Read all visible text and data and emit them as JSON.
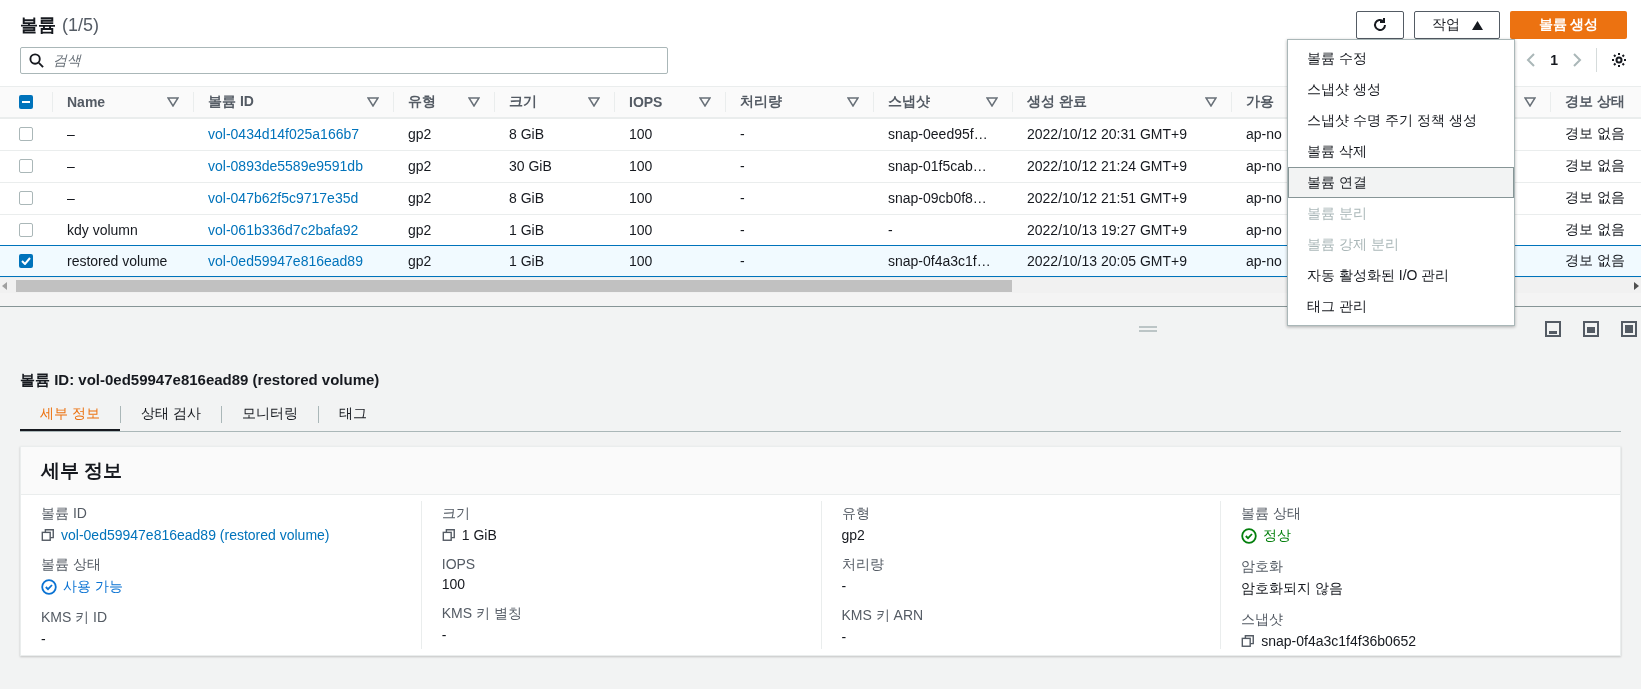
{
  "header": {
    "title": "볼륨",
    "count": "(1/5)",
    "actions_label": "작업",
    "create_label": "볼륨 생성"
  },
  "search": {
    "placeholder": "검색"
  },
  "pagination": {
    "page": "1"
  },
  "table": {
    "select_all": {
      "indeterminate": true
    },
    "columns": [
      {
        "label": "Name",
        "filter": true
      },
      {
        "label": "볼륨 ID",
        "filter": true
      },
      {
        "label": "유형",
        "filter": true
      },
      {
        "label": "크기",
        "filter": true
      },
      {
        "label": "IOPS",
        "filter": true
      },
      {
        "label": "처리량",
        "filter": true
      },
      {
        "label": "스냅샷",
        "filter": true
      },
      {
        "label": "생성 완료",
        "filter": true
      },
      {
        "label": "가용",
        "filter": true
      },
      {
        "label": "경보 상태",
        "filter": false
      }
    ],
    "rows": [
      {
        "selected": false,
        "cells": [
          "–",
          "vol-0434d14f025a166b7",
          "gp2",
          "8 GiB",
          "100",
          "-",
          "snap-0eed95f…",
          "2022/10/12 20:31 GMT+9",
          "ap-no",
          "경보 없음"
        ]
      },
      {
        "selected": false,
        "cells": [
          "–",
          "vol-0893de5589e9591db",
          "gp2",
          "30 GiB",
          "100",
          "-",
          "snap-01f5cab…",
          "2022/10/12 21:24 GMT+9",
          "ap-no",
          "경보 없음"
        ]
      },
      {
        "selected": false,
        "cells": [
          "–",
          "vol-047b62f5c9717e35d",
          "gp2",
          "8 GiB",
          "100",
          "-",
          "snap-09cb0f8…",
          "2022/10/12 21:51 GMT+9",
          "ap-no",
          "경보 없음"
        ]
      },
      {
        "selected": false,
        "cells": [
          "kdy volumn",
          "vol-061b336d7c2bafa92",
          "gp2",
          "1 GiB",
          "100",
          "-",
          "-",
          "2022/10/13 19:27 GMT+9",
          "ap-no",
          "경보 없음"
        ]
      },
      {
        "selected": true,
        "cells": [
          "restored volume",
          "vol-0ed59947e816ead89",
          "gp2",
          "1 GiB",
          "100",
          "-",
          "snap-0f4a3c1f…",
          "2022/10/13 20:05 GMT+9",
          "ap-no",
          "경보 없음"
        ]
      }
    ]
  },
  "actions_menu": [
    {
      "label": "볼륨 수정",
      "disabled": false,
      "selected": false
    },
    {
      "label": "스냅샷 생성",
      "disabled": false,
      "selected": false
    },
    {
      "label": "스냅샷 수명 주기 정책 생성",
      "disabled": false,
      "selected": false
    },
    {
      "label": "볼륨 삭제",
      "disabled": false,
      "selected": false
    },
    {
      "label": "볼륨 연결",
      "disabled": false,
      "selected": true
    },
    {
      "label": "볼륨 분리",
      "disabled": true,
      "selected": false
    },
    {
      "label": "볼륨 강제 분리",
      "disabled": true,
      "selected": false
    },
    {
      "label": "자동 활성화된 I/O 관리",
      "disabled": false,
      "selected": false
    },
    {
      "label": "태그 관리",
      "disabled": false,
      "selected": false
    }
  ],
  "detail": {
    "title": "볼륨 ID: vol-0ed59947e816ead89 (restored volume)",
    "tabs": [
      {
        "label": "세부 정보",
        "selected": true
      },
      {
        "label": "상태 검사",
        "selected": false
      },
      {
        "label": "모니터링",
        "selected": false
      },
      {
        "label": "태그",
        "selected": false
      }
    ],
    "card_title": "세부 정보",
    "columns": [
      [
        {
          "label": "볼륨 ID",
          "value": "vol-0ed59947e816ead89 (restored volume)",
          "kind": "copy_link"
        },
        {
          "label": "볼륨 상태",
          "value": "사용 가능",
          "kind": "status",
          "color": "#0972d3"
        },
        {
          "label": "KMS 키 ID",
          "value": "-",
          "kind": "text"
        }
      ],
      [
        {
          "label": "크기",
          "value": "1 GiB",
          "kind": "copy"
        },
        {
          "label": "IOPS",
          "value": "100",
          "kind": "text"
        },
        {
          "label": "KMS 키 별칭",
          "value": "-",
          "kind": "text"
        }
      ],
      [
        {
          "label": "유형",
          "value": "gp2",
          "kind": "text"
        },
        {
          "label": "처리량",
          "value": "-",
          "kind": "text"
        },
        {
          "label": "KMS 키 ARN",
          "value": "-",
          "kind": "text"
        }
      ],
      [
        {
          "label": "볼륨 상태",
          "value": "정상",
          "kind": "status",
          "color": "#037f0c"
        },
        {
          "label": "암호화",
          "value": "암호화되지 않음",
          "kind": "text"
        },
        {
          "label": "스냅샷",
          "value": "snap-0f4a3c1f4f36b0652",
          "kind": "copy"
        }
      ]
    ]
  }
}
